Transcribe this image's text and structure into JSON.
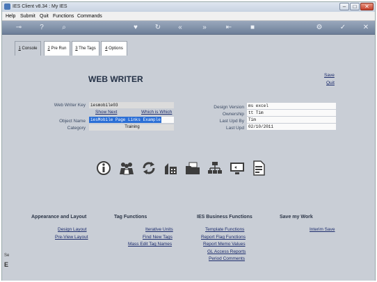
{
  "window": {
    "title": "IES Client v8.34 : My IES"
  },
  "menu": [
    "Help",
    "Submit",
    "Quit",
    "Functions",
    "Commands"
  ],
  "toolbar_icons": [
    "key-icon",
    "help-icon",
    "search-icon",
    "heart-icon",
    "refresh-icon",
    "rewind-icon",
    "fast-forward-icon",
    "first-icon",
    "stop-icon",
    "settings-icon",
    "check-icon",
    "close-icon"
  ],
  "tabs": [
    {
      "num": "1",
      "label": "Console"
    },
    {
      "num": "2",
      "label": "Pre Run"
    },
    {
      "num": "3",
      "label": "The Tags"
    },
    {
      "num": "4",
      "label": "Options"
    }
  ],
  "header": {
    "title": "WEB WRITER",
    "save": "Save",
    "quit": "Quit"
  },
  "form": {
    "key_label": "Web Writer Key",
    "key_value": "iesmobile03",
    "show_next": "Show Next",
    "which_is_which": "Which is Which",
    "object_label": "Object Name",
    "object_value": "iesMobile Page Links Example",
    "category_label": "Category",
    "category_value": "Training",
    "design_version_label": "Design Version",
    "design_version_value": "ms excel",
    "ownership_label": "Ownership",
    "ownership_value": "tt Tim",
    "last_upd_by_label": "Last Upd By",
    "last_upd_by_value": "Tim",
    "last_upd_label": "Last Upd",
    "last_upd_value": "02/10/2011"
  },
  "icons": [
    "info-icon",
    "users-icon",
    "cycle-icon",
    "build-icon",
    "folder-icon",
    "hierarchy-icon",
    "screen-icon",
    "document-icon"
  ],
  "sections": {
    "appearance": {
      "title": "Appearance and Layout",
      "links": [
        "Design Layout",
        "Pre-View Layout"
      ]
    },
    "tags": {
      "title": "Tag Functions",
      "links": [
        "Iterative Units",
        "Find New Tags",
        "Mass Edit Tag Names"
      ]
    },
    "business": {
      "title": "IES Business Functions",
      "links": [
        "Template Functions",
        "Report Flag Functions",
        "Report Memo Values",
        "GL Access Reports",
        "Period Comments"
      ]
    },
    "save": {
      "title": "Save my Work",
      "links": [
        "Interim Save"
      ]
    }
  },
  "side": {
    "line1": "Se",
    "line2": "E"
  },
  "colors": {
    "accent": "#2b6fd6",
    "panel": "#c9ced6",
    "heading": "#243146"
  }
}
